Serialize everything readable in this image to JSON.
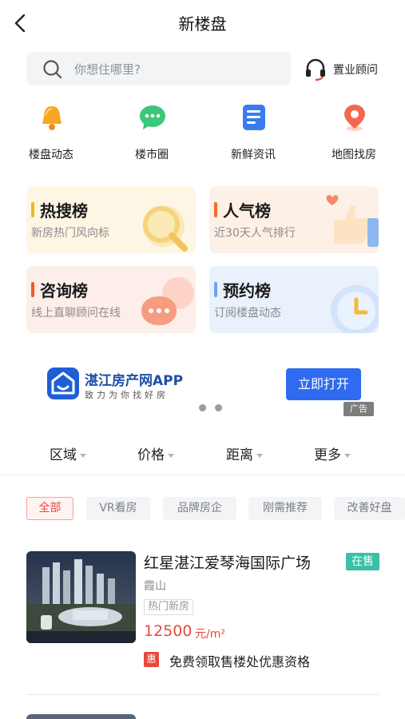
{
  "header": {
    "title": "新楼盘"
  },
  "search": {
    "placeholder": "你想住哪里?"
  },
  "consultant": {
    "label": "置业顾问"
  },
  "quick_links": [
    {
      "label": "楼盘动态",
      "icon": "bell-icon"
    },
    {
      "label": "楼市圈",
      "icon": "chat-bubble-icon"
    },
    {
      "label": "新鲜资讯",
      "icon": "news-icon"
    },
    {
      "label": "地图找房",
      "icon": "map-pin-icon"
    }
  ],
  "rankings": [
    {
      "title": "热搜榜",
      "subtitle": "新房热门风向标",
      "accent": "#f0b429",
      "bg": "#fdf6e5",
      "icon": "magnifier-icon"
    },
    {
      "title": "人气榜",
      "subtitle": "近30天人气排行",
      "accent": "#f26a2e",
      "bg": "#fdf0e6",
      "icon": "thumbs-up-icon"
    },
    {
      "title": "咨询榜",
      "subtitle": "线上直聊顾问在线",
      "accent": "#ee5a2c",
      "bg": "#fdeeea",
      "icon": "speech-bubble-icon"
    },
    {
      "title": "预约榜",
      "subtitle": "订阅楼盘动态",
      "accent": "#6aa5f2",
      "bg": "#e9f1fd",
      "icon": "clock-icon"
    }
  ],
  "ad": {
    "app_name": "湛江房产网APP",
    "slogan": "致力为你找好房",
    "button": "立即打开",
    "tag": "广告"
  },
  "filters": [
    {
      "label": "区域"
    },
    {
      "label": "价格"
    },
    {
      "label": "距离"
    },
    {
      "label": "更多"
    }
  ],
  "chips": [
    {
      "label": "全部",
      "active": true
    },
    {
      "label": "VR看房",
      "active": false
    },
    {
      "label": "品牌房企",
      "active": false
    },
    {
      "label": "刚需推荐",
      "active": false
    },
    {
      "label": "改善好盘",
      "active": false
    }
  ],
  "listing": {
    "title": "红星湛江爱琴海国际广场",
    "status": "在售",
    "area": "霞山",
    "tag": "热门新房",
    "price": "12500",
    "unit": "元/m²",
    "promo_icon": "惠",
    "promo": "免费领取售楼处优惠资格"
  },
  "colors": {
    "accent_blue": "#2f6bf0",
    "price_red": "#e84a3b",
    "status_green": "#39c0a6"
  }
}
